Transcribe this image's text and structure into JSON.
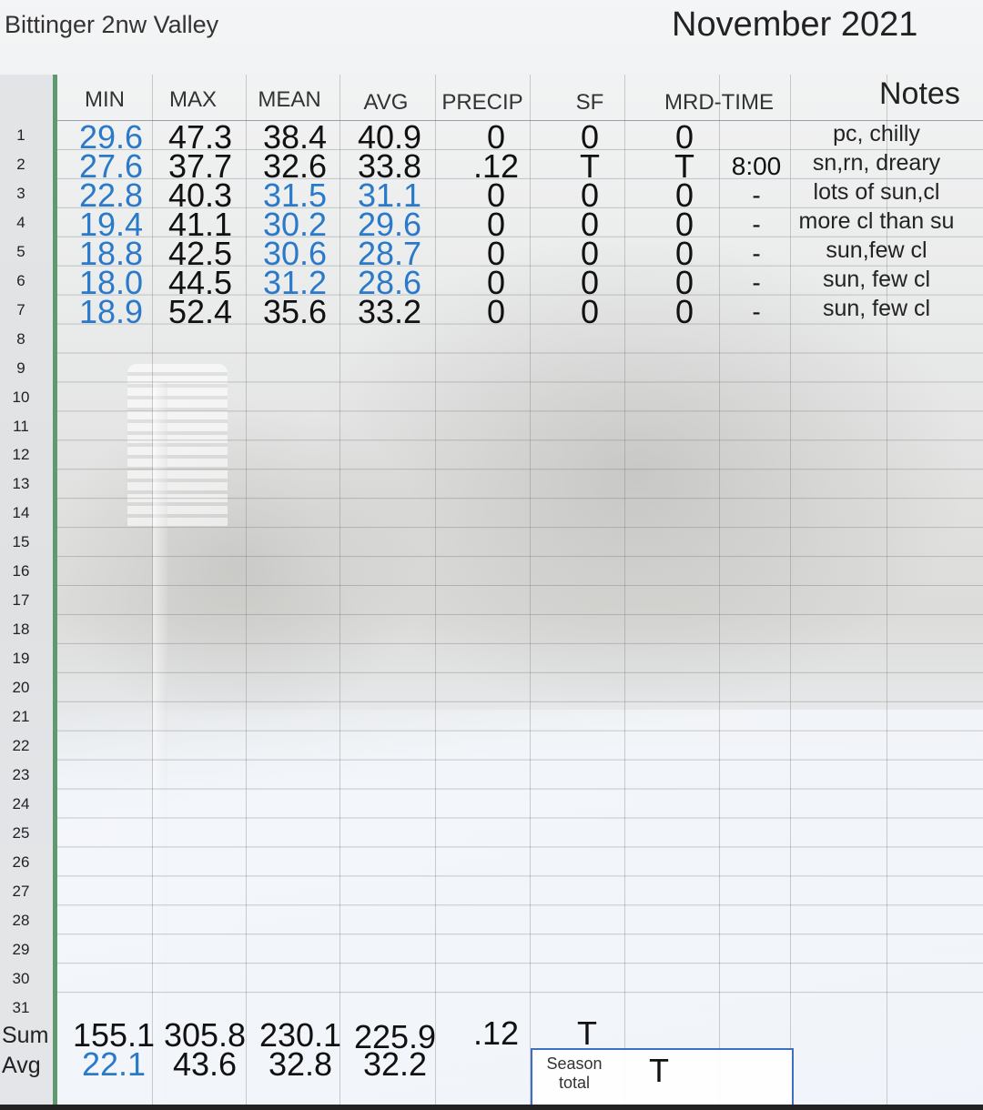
{
  "app_title": "Bittinger 2nw Valley",
  "month": "November 2021",
  "columns": [
    "MIN",
    "MAX",
    "MEAN",
    "AVG",
    "PRECIP",
    "SF",
    "MRD-TIME"
  ],
  "notes_header": "Notes",
  "rows": [
    {
      "n": "1",
      "min": "29.6",
      "max": "47.3",
      "mean": "38.4",
      "avg": "40.9",
      "precip": "0",
      "sf": "0",
      "mrd": "0",
      "time": "",
      "note": "pc, chilly"
    },
    {
      "n": "2",
      "min": "27.6",
      "max": "37.7",
      "mean": "32.6",
      "avg": "33.8",
      "precip": ".12",
      "sf": "T",
      "mrd": "T",
      "time": "8:00",
      "note": "sn,rn, dreary"
    },
    {
      "n": "3",
      "min": "22.8",
      "max": "40.3",
      "mean": "31.5",
      "avg": "31.1",
      "precip": "0",
      "sf": "0",
      "mrd": "0",
      "time": "-",
      "note": "lots of sun,cl"
    },
    {
      "n": "4",
      "min": "19.4",
      "max": "41.1",
      "mean": "30.2",
      "avg": "29.6",
      "precip": "0",
      "sf": "0",
      "mrd": "0",
      "time": "-",
      "note": "more cl than su"
    },
    {
      "n": "5",
      "min": "18.8",
      "max": "42.5",
      "mean": "30.6",
      "avg": "28.7",
      "precip": "0",
      "sf": "0",
      "mrd": "0",
      "time": "-",
      "note": "sun,few cl"
    },
    {
      "n": "6",
      "min": "18.0",
      "max": "44.5",
      "mean": "31.2",
      "avg": "28.6",
      "precip": "0",
      "sf": "0",
      "mrd": "0",
      "time": "-",
      "note": "sun, few cl"
    },
    {
      "n": "7",
      "min": "18.9",
      "max": "52.4",
      "mean": "35.6",
      "avg": "33.2",
      "precip": "0",
      "sf": "0",
      "mrd": "0",
      "time": "-",
      "note": "sun, few cl"
    }
  ],
  "row_numbers": [
    "1",
    "2",
    "3",
    "4",
    "5",
    "6",
    "7",
    "8",
    "9",
    "10",
    "11",
    "12",
    "13",
    "14",
    "15",
    "16",
    "17",
    "18",
    "19",
    "20",
    "21",
    "22",
    "23",
    "24",
    "25",
    "26",
    "27",
    "28",
    "29",
    "30",
    "31"
  ],
  "sum": {
    "label": "Sum",
    "min": "155.1",
    "max": "305.8",
    "mean": "230.1",
    "avg": "225.9",
    "precip": ".12",
    "sf": "T"
  },
  "avg": {
    "label": "Avg",
    "min": "22.1",
    "max": "43.6",
    "mean": "32.8",
    "avg": "32.2"
  },
  "season": {
    "label": "Season total",
    "value": "T"
  },
  "colors": {
    "highlight": "#2a7ac9",
    "frozen_line": "#5f9a6e",
    "selection": "#3f6fc4"
  }
}
